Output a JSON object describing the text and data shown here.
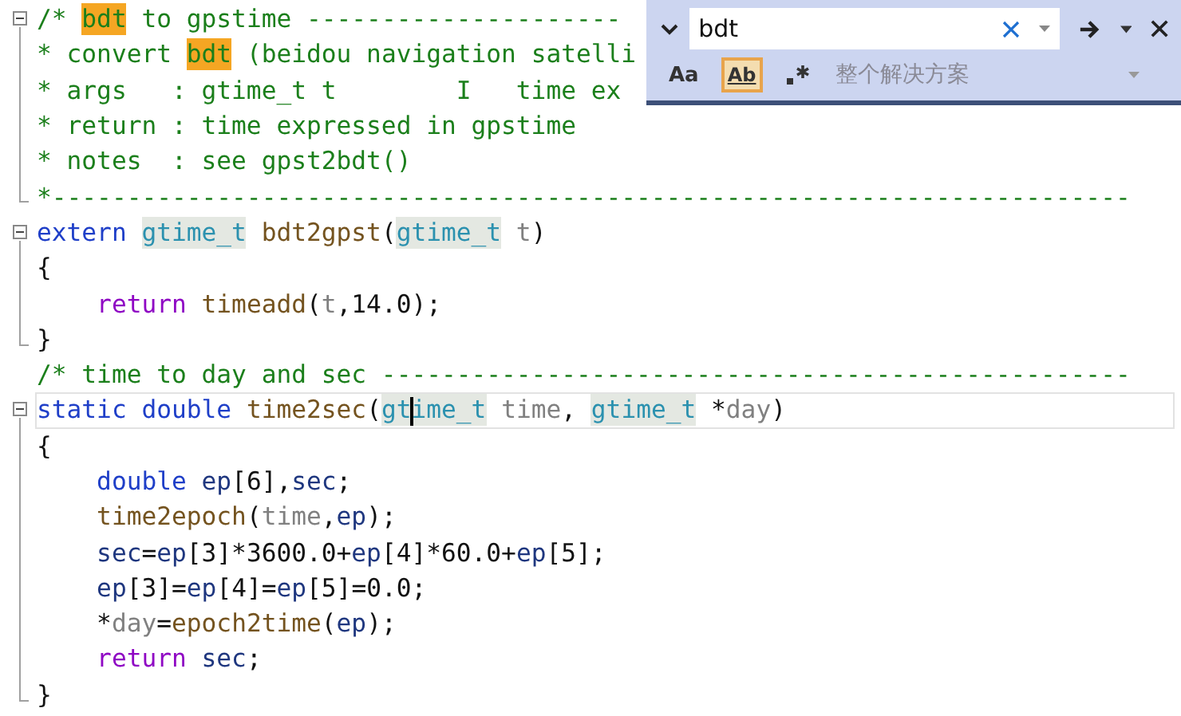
{
  "editor": {
    "lines": [
      {
        "collapsible": true,
        "in_block": false,
        "block_end": false,
        "current": false,
        "tokens": [
          {
            "text": "/* ",
            "kind": "comment"
          },
          {
            "text": "bdt",
            "kind": "comment",
            "match": true
          },
          {
            "text": " to gpstime ---------------------",
            "kind": "comment"
          }
        ]
      },
      {
        "collapsible": false,
        "in_block": true,
        "block_end": false,
        "current": false,
        "tokens": [
          {
            "text": "* convert ",
            "kind": "comment"
          },
          {
            "text": "bdt",
            "kind": "comment",
            "match": true
          },
          {
            "text": " (beidou navigation satelli",
            "kind": "comment"
          }
        ]
      },
      {
        "collapsible": false,
        "in_block": true,
        "block_end": false,
        "current": false,
        "tokens": [
          {
            "text": "* args   : gtime_t t        I   time ex",
            "kind": "comment"
          }
        ]
      },
      {
        "collapsible": false,
        "in_block": true,
        "block_end": false,
        "current": false,
        "tokens": [
          {
            "text": "* return : time expressed in gpstime",
            "kind": "comment"
          }
        ]
      },
      {
        "collapsible": false,
        "in_block": true,
        "block_end": false,
        "current": false,
        "tokens": [
          {
            "text": "* notes  : see gpst2bdt()",
            "kind": "comment"
          }
        ]
      },
      {
        "collapsible": false,
        "in_block": true,
        "block_end": true,
        "current": false,
        "tokens": [
          {
            "text": "*------------------------------------------------------------------------",
            "kind": "comment"
          }
        ]
      },
      {
        "collapsible": true,
        "in_block": false,
        "block_end": false,
        "current": false,
        "tokens": [
          {
            "text": "extern ",
            "kind": "keyword"
          },
          {
            "text": "gtime_t",
            "kind": "type",
            "reference": true
          },
          {
            "text": " bdt2gpst",
            "kind": "function"
          },
          {
            "text": "(",
            "kind": "plain"
          },
          {
            "text": "gtime_t",
            "kind": "type",
            "reference": true
          },
          {
            "text": " t",
            "kind": "param"
          },
          {
            "text": ")",
            "kind": "plain"
          }
        ]
      },
      {
        "collapsible": false,
        "in_block": true,
        "block_end": false,
        "current": false,
        "tokens": [
          {
            "text": "{",
            "kind": "plain"
          }
        ]
      },
      {
        "collapsible": false,
        "in_block": true,
        "block_end": false,
        "current": false,
        "tokens": [
          {
            "text": "    return",
            "kind": "control"
          },
          {
            "text": " timeadd",
            "kind": "function"
          },
          {
            "text": "(",
            "kind": "plain"
          },
          {
            "text": "t",
            "kind": "param"
          },
          {
            "text": ",14.0);",
            "kind": "plain"
          }
        ]
      },
      {
        "collapsible": false,
        "in_block": true,
        "block_end": true,
        "current": false,
        "tokens": [
          {
            "text": "}",
            "kind": "plain"
          }
        ]
      },
      {
        "collapsible": false,
        "in_block": false,
        "block_end": false,
        "current": false,
        "tokens": [
          {
            "text": "/* time to day and sec --------------------------------------------------",
            "kind": "comment"
          }
        ]
      },
      {
        "collapsible": true,
        "in_block": false,
        "block_end": false,
        "current": true,
        "tokens": [
          {
            "text": "static double",
            "kind": "keyword"
          },
          {
            "text": " time2sec",
            "kind": "function"
          },
          {
            "text": "(",
            "kind": "plain"
          },
          {
            "text": "gtime_t",
            "kind": "type",
            "reference": true,
            "caret": true
          },
          {
            "text": " time",
            "kind": "param"
          },
          {
            "text": ", ",
            "kind": "plain"
          },
          {
            "text": "gtime_t",
            "kind": "type",
            "reference": true
          },
          {
            "text": " *",
            "kind": "plain"
          },
          {
            "text": "day",
            "kind": "param"
          },
          {
            "text": ")",
            "kind": "plain"
          }
        ]
      },
      {
        "collapsible": false,
        "in_block": true,
        "block_end": false,
        "current": false,
        "tokens": [
          {
            "text": "{",
            "kind": "plain"
          }
        ]
      },
      {
        "collapsible": false,
        "in_block": true,
        "block_end": false,
        "current": false,
        "tokens": [
          {
            "text": "    double",
            "kind": "keyword"
          },
          {
            "text": " ep",
            "kind": "variable"
          },
          {
            "text": "[6],",
            "kind": "plain"
          },
          {
            "text": "sec",
            "kind": "variable"
          },
          {
            "text": ";",
            "kind": "plain"
          }
        ]
      },
      {
        "collapsible": false,
        "in_block": true,
        "block_end": false,
        "current": false,
        "tokens": [
          {
            "text": "    time2epoch",
            "kind": "function"
          },
          {
            "text": "(",
            "kind": "plain"
          },
          {
            "text": "time",
            "kind": "param"
          },
          {
            "text": ",",
            "kind": "plain"
          },
          {
            "text": "ep",
            "kind": "variable"
          },
          {
            "text": ");",
            "kind": "plain"
          }
        ]
      },
      {
        "collapsible": false,
        "in_block": true,
        "block_end": false,
        "current": false,
        "tokens": [
          {
            "text": "    sec",
            "kind": "variable"
          },
          {
            "text": "=",
            "kind": "plain"
          },
          {
            "text": "ep",
            "kind": "variable"
          },
          {
            "text": "[3]*3600.0+",
            "kind": "plain"
          },
          {
            "text": "ep",
            "kind": "variable"
          },
          {
            "text": "[4]*60.0+",
            "kind": "plain"
          },
          {
            "text": "ep",
            "kind": "variable"
          },
          {
            "text": "[5];",
            "kind": "plain"
          }
        ]
      },
      {
        "collapsible": false,
        "in_block": true,
        "block_end": false,
        "current": false,
        "tokens": [
          {
            "text": "    ep",
            "kind": "variable"
          },
          {
            "text": "[3]=",
            "kind": "plain"
          },
          {
            "text": "ep",
            "kind": "variable"
          },
          {
            "text": "[4]=",
            "kind": "plain"
          },
          {
            "text": "ep",
            "kind": "variable"
          },
          {
            "text": "[5]=0.0;",
            "kind": "plain"
          }
        ]
      },
      {
        "collapsible": false,
        "in_block": true,
        "block_end": false,
        "current": false,
        "tokens": [
          {
            "text": "    *",
            "kind": "plain"
          },
          {
            "text": "day",
            "kind": "param"
          },
          {
            "text": "=",
            "kind": "plain"
          },
          {
            "text": "epoch2time",
            "kind": "function"
          },
          {
            "text": "(",
            "kind": "plain"
          },
          {
            "text": "ep",
            "kind": "variable"
          },
          {
            "text": ");",
            "kind": "plain"
          }
        ]
      },
      {
        "collapsible": false,
        "in_block": true,
        "block_end": false,
        "current": false,
        "tokens": [
          {
            "text": "    return",
            "kind": "control"
          },
          {
            "text": " sec",
            "kind": "variable"
          },
          {
            "text": ";",
            "kind": "plain"
          }
        ]
      },
      {
        "collapsible": false,
        "in_block": true,
        "block_end": true,
        "current": false,
        "tokens": [
          {
            "text": "}",
            "kind": "plain"
          }
        ]
      }
    ]
  },
  "find_widget": {
    "expanded": true,
    "search": {
      "value": "bdt"
    },
    "options": [
      {
        "kind": "text",
        "label": "Aa",
        "selected": false
      },
      {
        "kind": "word",
        "label": "Ab",
        "selected": true
      },
      {
        "kind": "regex",
        "selected": false
      }
    ],
    "scope": "整个解决方案"
  }
}
